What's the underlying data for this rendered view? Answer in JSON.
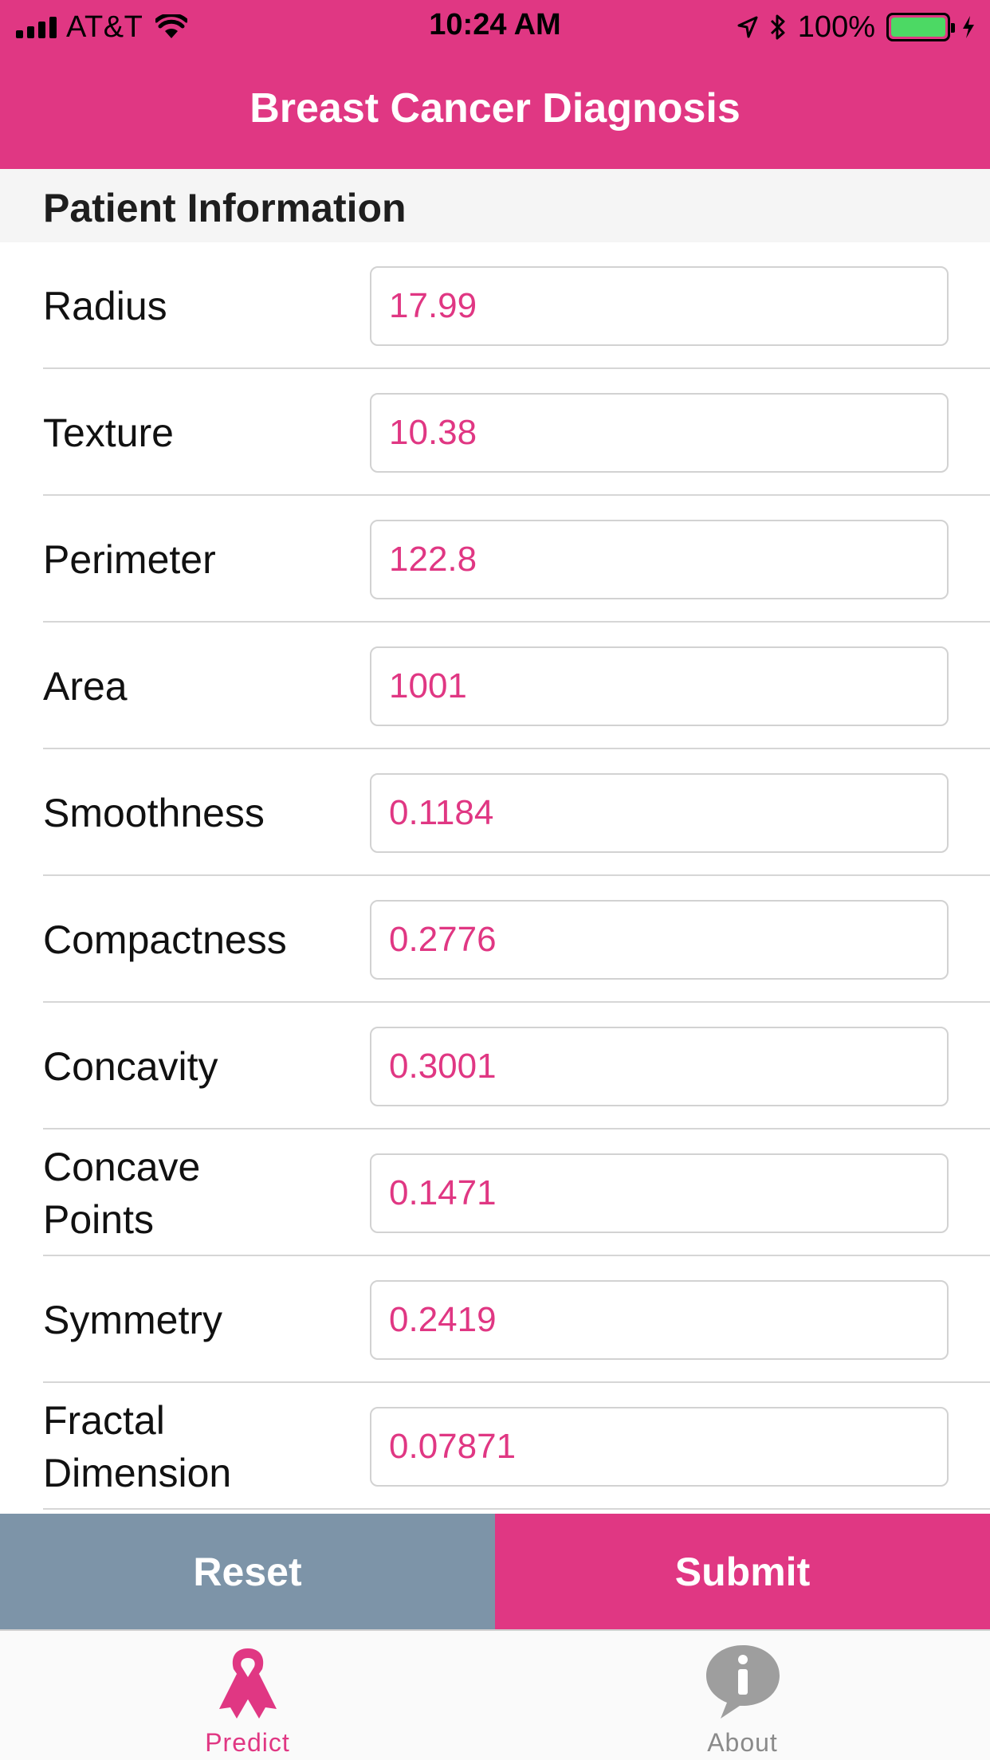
{
  "status_bar": {
    "carrier": "AT&T",
    "time": "10:24 AM",
    "battery_percent": "100%",
    "icons": [
      "signal-icon",
      "wifi-icon",
      "location-icon",
      "bluetooth-icon",
      "battery-icon",
      "charging-icon"
    ]
  },
  "nav": {
    "title": "Breast Cancer Diagnosis"
  },
  "section": {
    "title": "Patient Information"
  },
  "fields": [
    {
      "label": "Radius",
      "value": "17.99"
    },
    {
      "label": "Texture",
      "value": "10.38"
    },
    {
      "label": "Perimeter",
      "value": "122.8"
    },
    {
      "label": "Area",
      "value": "1001"
    },
    {
      "label": "Smoothness",
      "value": "0.1184"
    },
    {
      "label": "Compactness",
      "value": "0.2776"
    },
    {
      "label": "Concavity",
      "value": "0.3001"
    },
    {
      "label": "Concave Points",
      "value": "0.1471"
    },
    {
      "label": "Symmetry",
      "value": "0.2419"
    },
    {
      "label": "Fractal Dimension",
      "value": "0.07871"
    }
  ],
  "actions": {
    "reset_label": "Reset",
    "submit_label": "Submit"
  },
  "tabs": [
    {
      "label": "Predict",
      "icon": "ribbon-icon",
      "active": true
    },
    {
      "label": "About",
      "icon": "info-bubble-icon",
      "active": false
    }
  ],
  "colors": {
    "accent": "#e03783",
    "reset_button": "#7d94a8",
    "battery_fill": "#4cd964",
    "inactive_tab": "#8a8a8a"
  }
}
